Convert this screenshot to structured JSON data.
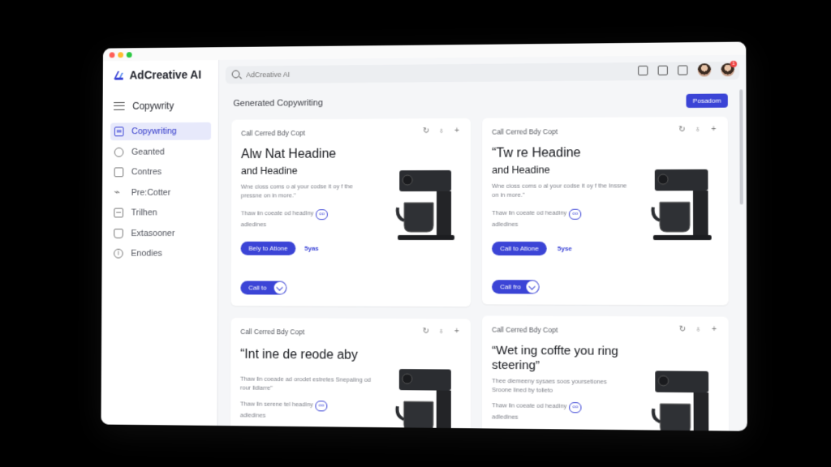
{
  "brand": {
    "name": "AdCreative AI",
    "color": "#3b44d6"
  },
  "sidebar": {
    "menu_label": "Copywrity",
    "items": [
      {
        "label": "Copywriting",
        "icon": "doc-icon",
        "active": true
      },
      {
        "label": "Geanted",
        "icon": "circle-icon"
      },
      {
        "label": "Contres",
        "icon": "box-icon"
      },
      {
        "label": "Pre:Cotter",
        "icon": "link-icon"
      },
      {
        "label": "Trilhen",
        "icon": "grid-icon"
      },
      {
        "label": "Extasooner",
        "icon": "tag-icon"
      },
      {
        "label": "Enodies",
        "icon": "info-icon"
      }
    ]
  },
  "topbar": {
    "search_placeholder": "AdCreative AI",
    "notification_count": "1"
  },
  "main": {
    "section_title": "Generated Copywriting",
    "primary_button": "Posadom"
  },
  "cards": [
    {
      "title": "Call Cerred Bdy Copt",
      "headline": "Alw Nat Headine",
      "subheadline": "and Headine",
      "body": "Wne cioss coms o al your codse it oy f the pressne on in more.\"",
      "note": "Thaw lin coeate od headiny",
      "note_chip": "oo",
      "note_tail": "adledines",
      "cta": "Bely to Atione",
      "cta_meta": "5yas",
      "toggle_label": "Call to"
    },
    {
      "title": "Call Cerred Bdy Copt",
      "headline": "“Tw re Headine",
      "subheadline": "and Headine",
      "body": "Wne cioss coms o al your codse it oy f the Inssne on in more.\"",
      "note": "Thaw lin coeate od headiny",
      "note_chip": "oo",
      "note_tail": "adledines",
      "cta": "Call to Atione",
      "cta_meta": "5yse",
      "toggle_label": "Call fro"
    },
    {
      "title": "Call Cerred Bdy Copt",
      "headline": "“Int ine de reode aby",
      "body": "Thaw lin coeade ad orodet estretes Snepaling od rour lidiarre\"",
      "note": "Thaw lin serene tel headiny",
      "note_chip": "oo",
      "note_tail": "adledines"
    },
    {
      "title": "Call Cerred Bdy Copt",
      "headline": "“Wet ing coffte you ring steering”",
      "body": "Thee diemeeny sysaes soos yoursetiones Sroone lined by tolieto",
      "note": "Thaw lin coeate od headiny",
      "note_chip": "oo",
      "note_tail": "adledines"
    }
  ]
}
